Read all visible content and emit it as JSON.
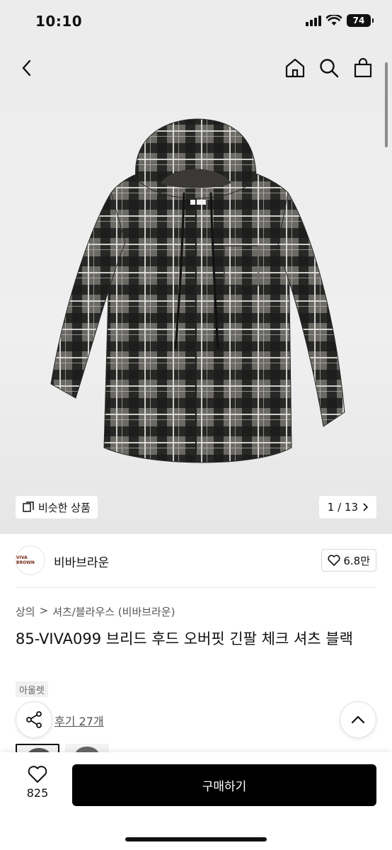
{
  "status_bar": {
    "time": "10:10",
    "battery": "74"
  },
  "nav": {
    "back": "back",
    "home": "home",
    "search": "search",
    "cart": "cart"
  },
  "gallery": {
    "similar_label": "비슷한 상품",
    "counter": "1 / 13",
    "label_text": "VIVA BROWN"
  },
  "brand": {
    "logo_text": "VIVA BROWN",
    "name": "비바브라운",
    "likes": "6.8만"
  },
  "breadcrumb": {
    "level1": "상의",
    "separator": ">",
    "level2": "셔츠/블라우스 (비바브라운)"
  },
  "product": {
    "title": "85-VIVA099 브리드 후드 오버핏 긴팔 체크 셔츠 블랙",
    "tag": "아울렛",
    "reviews": "후기 27개"
  },
  "bottom": {
    "wish_count": "825",
    "buy_label": "구매하기"
  },
  "colors": {
    "accent": "#000000",
    "hero_bg": "#ececec"
  }
}
